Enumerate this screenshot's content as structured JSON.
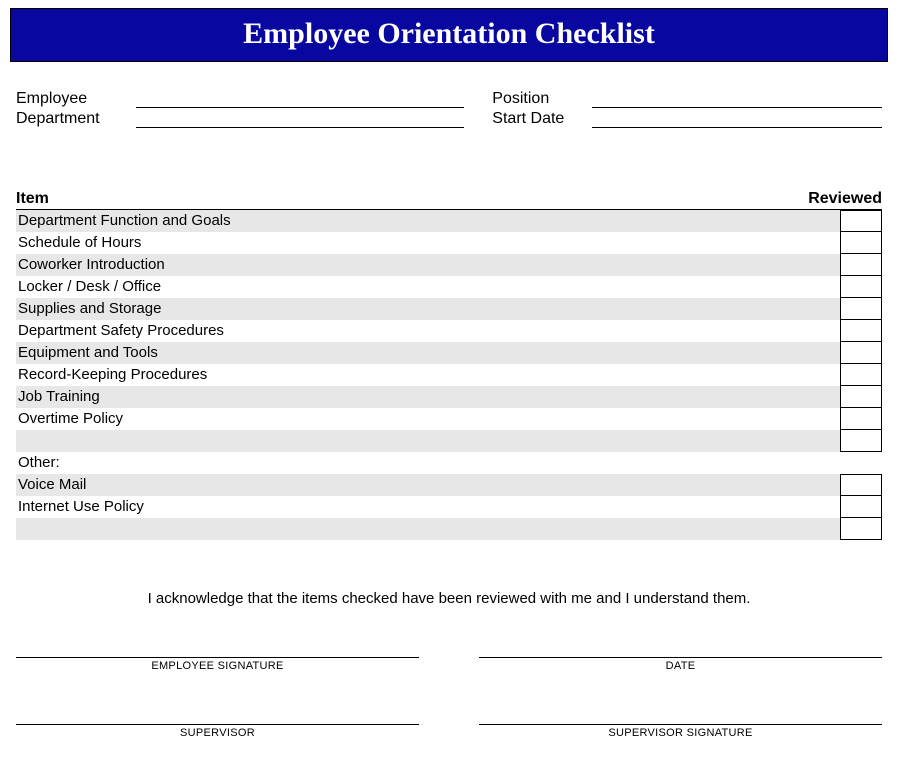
{
  "title": "Employee Orientation Checklist",
  "info": {
    "employee_label": "Employee",
    "department_label": "Department",
    "position_label": "Position",
    "start_date_label": "Start Date"
  },
  "columns": {
    "item": "Item",
    "reviewed": "Reviewed"
  },
  "items": [
    {
      "label": "Department Function and Goals",
      "box": true
    },
    {
      "label": "Schedule of Hours",
      "box": true
    },
    {
      "label": "Coworker Introduction",
      "box": true
    },
    {
      "label": "Locker / Desk / Office",
      "box": true
    },
    {
      "label": "Supplies and Storage",
      "box": true
    },
    {
      "label": "Department Safety Procedures",
      "box": true
    },
    {
      "label": "Equipment and Tools",
      "box": true
    },
    {
      "label": "Record-Keeping Procedures",
      "box": true
    },
    {
      "label": "Job Training",
      "box": true
    },
    {
      "label": "Overtime Policy",
      "box": true
    },
    {
      "label": "",
      "box": true
    },
    {
      "label": "Other:",
      "box": false
    },
    {
      "label": "Voice Mail",
      "box": true
    },
    {
      "label": "Internet Use Policy",
      "box": true
    },
    {
      "label": "",
      "box": true
    }
  ],
  "ack_text": "I acknowledge that the items checked have been reviewed with me and I understand them.",
  "sig": {
    "employee": "EMPLOYEE SIGNATURE",
    "date": "DATE",
    "supervisor": "SUPERVISOR",
    "supervisor_sig": "SUPERVISOR SIGNATURE"
  }
}
